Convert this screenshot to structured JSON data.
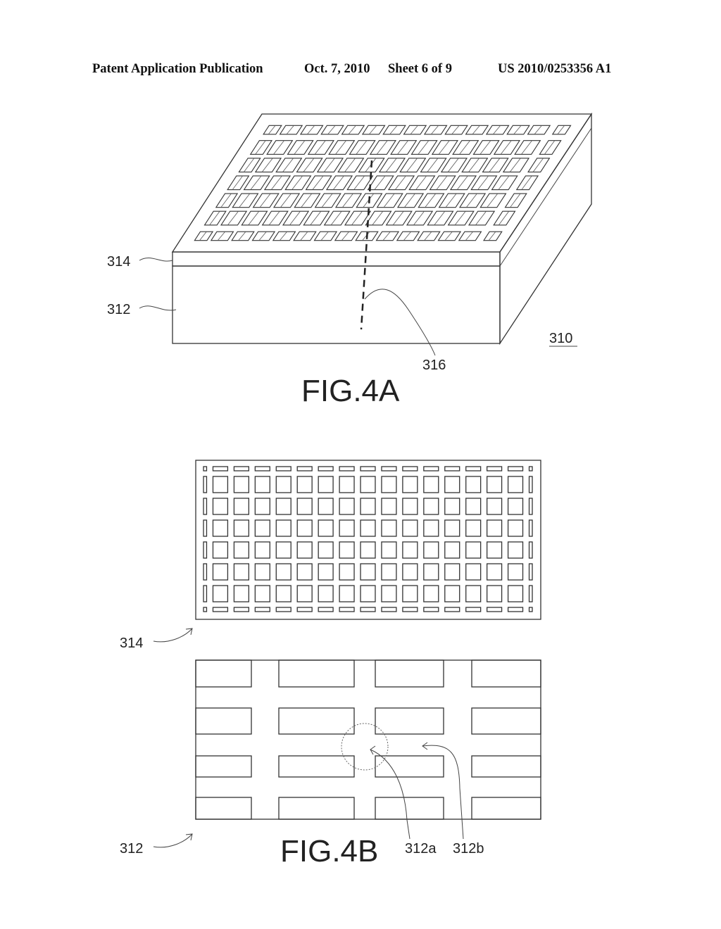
{
  "header": {
    "publication": "Patent Application Publication",
    "date": "Oct. 7, 2010",
    "sheet": "Sheet 6 of 9",
    "number": "US 2010/0253356 A1"
  },
  "fig4a": {
    "caption": "FIG.4A",
    "labels": {
      "layer_top": "314",
      "layer_bottom": "312",
      "cut_line": "316",
      "assembly": "310"
    },
    "grid": {
      "rows": 7,
      "cols": 15
    }
  },
  "fig4b": {
    "caption": "FIG.4B",
    "labels": {
      "top_plate": "314",
      "bottom_plate": "312",
      "region_a": "312a",
      "region_b": "312b"
    },
    "top_grid": {
      "rows": 8,
      "cols": 17
    },
    "bottom_grid": {
      "rows": 4,
      "cols": 4
    }
  }
}
